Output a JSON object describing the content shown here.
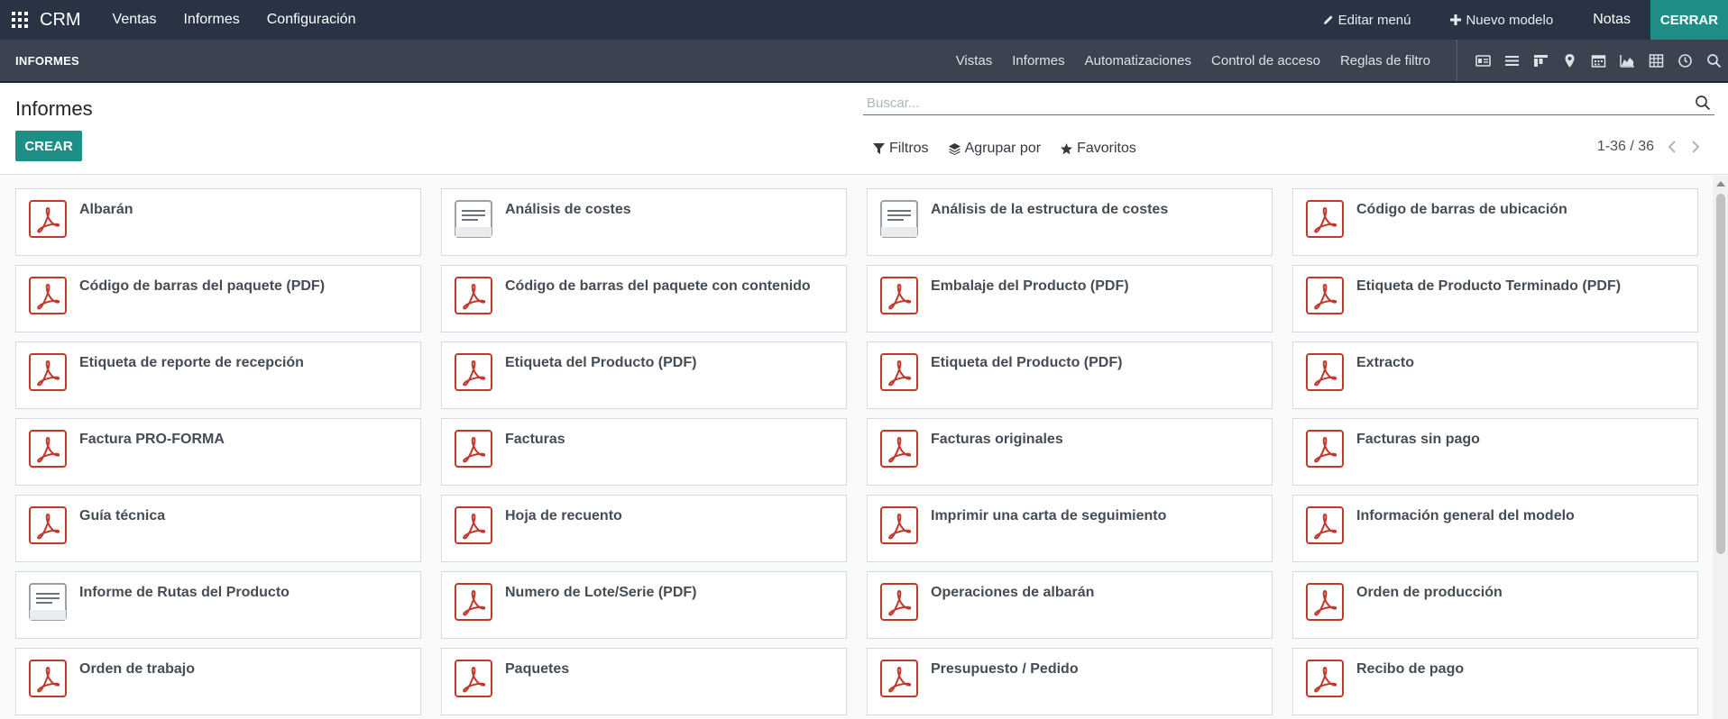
{
  "topbar": {
    "brand": "CRM",
    "menu": [
      "Ventas",
      "Informes",
      "Configuración"
    ],
    "edit_menu": "Editar menú",
    "new_model": "Nuevo modelo",
    "notes": "Notas",
    "close": "CERRAR"
  },
  "subbar": {
    "title": "INFORMES",
    "menu": [
      "Vistas",
      "Informes",
      "Automatizaciones",
      "Control de acceso",
      "Reglas de filtro"
    ],
    "view_icons": [
      "id-card-icon",
      "list-icon",
      "kanban-icon",
      "map-pin-icon",
      "calendar-icon",
      "graph-icon",
      "pivot-icon",
      "clock-icon",
      "search-icon"
    ]
  },
  "control": {
    "title": "Informes",
    "create": "CREAR",
    "search_placeholder": "Buscar...",
    "filters": "Filtros",
    "group_by": "Agrupar por",
    "favorites": "Favoritos",
    "pager": "1-36 / 36"
  },
  "colors": {
    "navbar": "#283444",
    "subbar": "#3a434f",
    "accent": "#1e8e86",
    "pdf_red": "#c0392b"
  },
  "cards": [
    {
      "label": "Albarán",
      "icon": "pdf-icon"
    },
    {
      "label": "Análisis de costes",
      "icon": "document-icon"
    },
    {
      "label": "Análisis de la estructura de costes",
      "icon": "document-icon"
    },
    {
      "label": "Código de barras de ubicación",
      "icon": "pdf-icon"
    },
    {
      "label": "Código de barras del paquete (PDF)",
      "icon": "pdf-icon"
    },
    {
      "label": "Código de barras del paquete con contenido",
      "icon": "pdf-icon"
    },
    {
      "label": "Embalaje del Producto (PDF)",
      "icon": "pdf-icon"
    },
    {
      "label": "Etiqueta de Producto Terminado (PDF)",
      "icon": "pdf-icon"
    },
    {
      "label": "Etiqueta de reporte de recepción",
      "icon": "pdf-icon"
    },
    {
      "label": "Etiqueta del Producto (PDF)",
      "icon": "pdf-icon"
    },
    {
      "label": "Etiqueta del Producto (PDF)",
      "icon": "pdf-icon"
    },
    {
      "label": "Extracto",
      "icon": "pdf-icon"
    },
    {
      "label": "Factura PRO-FORMA",
      "icon": "pdf-icon"
    },
    {
      "label": "Facturas",
      "icon": "pdf-icon"
    },
    {
      "label": "Facturas originales",
      "icon": "pdf-icon"
    },
    {
      "label": "Facturas sin pago",
      "icon": "pdf-icon"
    },
    {
      "label": "Guía técnica",
      "icon": "pdf-icon"
    },
    {
      "label": "Hoja de recuento",
      "icon": "pdf-icon"
    },
    {
      "label": "Imprimir una carta de seguimiento",
      "icon": "pdf-icon"
    },
    {
      "label": "Información general del modelo",
      "icon": "pdf-icon"
    },
    {
      "label": "Informe de Rutas del Producto",
      "icon": "document-icon"
    },
    {
      "label": "Numero de Lote/Serie (PDF)",
      "icon": "pdf-icon"
    },
    {
      "label": "Operaciones de albarán",
      "icon": "pdf-icon"
    },
    {
      "label": "Orden de producción",
      "icon": "pdf-icon"
    },
    {
      "label": "Orden de trabajo",
      "icon": "pdf-icon"
    },
    {
      "label": "Paquetes",
      "icon": "pdf-icon"
    },
    {
      "label": "Presupuesto / Pedido",
      "icon": "pdf-icon"
    },
    {
      "label": "Recibo de pago",
      "icon": "pdf-icon"
    }
  ]
}
